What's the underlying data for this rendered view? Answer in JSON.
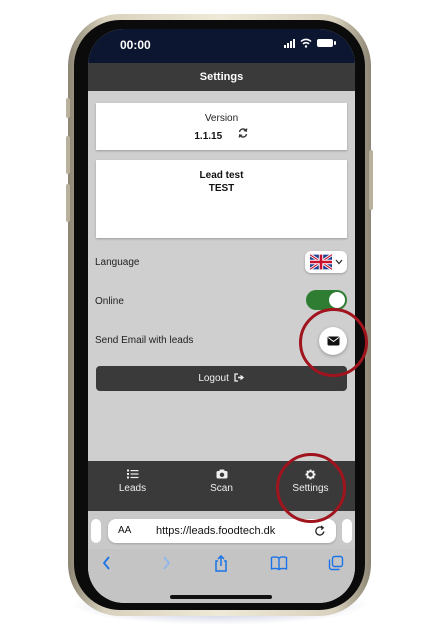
{
  "status_bar": {
    "time": "00:00"
  },
  "header": {
    "title": "Settings"
  },
  "version_card": {
    "label": "Version",
    "value": "1.1.15"
  },
  "lead_card": {
    "title": "Lead test",
    "subtitle": "TEST"
  },
  "settings": {
    "language_label": "Language",
    "online_label": "Online",
    "online_enabled": true,
    "email_label": "Send Email with leads"
  },
  "logout": {
    "label": "Logout"
  },
  "tabs": [
    {
      "label": "Leads",
      "icon": "list-icon"
    },
    {
      "label": "Scan",
      "icon": "camera-icon"
    },
    {
      "label": "Settings",
      "icon": "gear-icon"
    }
  ],
  "browser": {
    "aa_label": "AA",
    "url": "https://leads.foodtech.dk"
  },
  "colors": {
    "accent_dark": "#3a3a3a",
    "toggle_on": "#2e7d32",
    "annotation": "#a0141e",
    "status_bar": "#0c1630",
    "ios_blue": "#1a73e8"
  }
}
